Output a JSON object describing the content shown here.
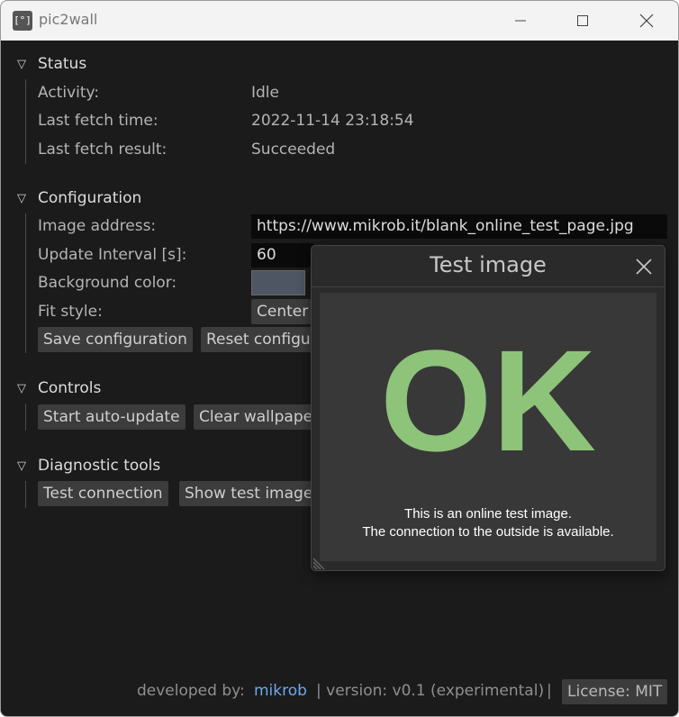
{
  "window": {
    "title": "pic2wall",
    "icon": "app-icon",
    "icon_text": "[°]"
  },
  "status": {
    "header": "Status",
    "rows": [
      {
        "label": "Activity:",
        "value": "Idle"
      },
      {
        "label": "Last fetch time:",
        "value": "2022-11-14 23:18:54"
      },
      {
        "label": "Last fetch result:",
        "value": "Succeeded"
      }
    ]
  },
  "configuration": {
    "header": "Configuration",
    "image_address_label": "Image address:",
    "image_address_value": "https://www.mikrob.it/blank_online_test_page.jpg",
    "update_interval_label": "Update Interval [s]:",
    "update_interval_value": "60",
    "background_color_label": "Background color:",
    "background_color_value": "#4e5563",
    "fit_style_label": "Fit style:",
    "fit_style_value": "Center",
    "save_button": "Save configuration",
    "reset_button": "Reset configu"
  },
  "controls": {
    "header": "Controls",
    "start_button": "Start auto-update",
    "clear_button": "Clear wallpape"
  },
  "diagnostic": {
    "header": "Diagnostic tools",
    "test_button": "Test connection",
    "show_button": "Show test image"
  },
  "test_window": {
    "title": "Test image",
    "image_big_text": "OK",
    "image_line1": "This is an online test image.",
    "image_line2": "The connection to the outside is available.",
    "ok_color": "#8ec37a"
  },
  "footer": {
    "developed_by": "developed by:",
    "author_link": "mikrob",
    "version_text": "| version: v0.1 (experimental)",
    "separator": "|",
    "license_button": "License: MIT",
    "link_color": "#6fa8e8"
  }
}
